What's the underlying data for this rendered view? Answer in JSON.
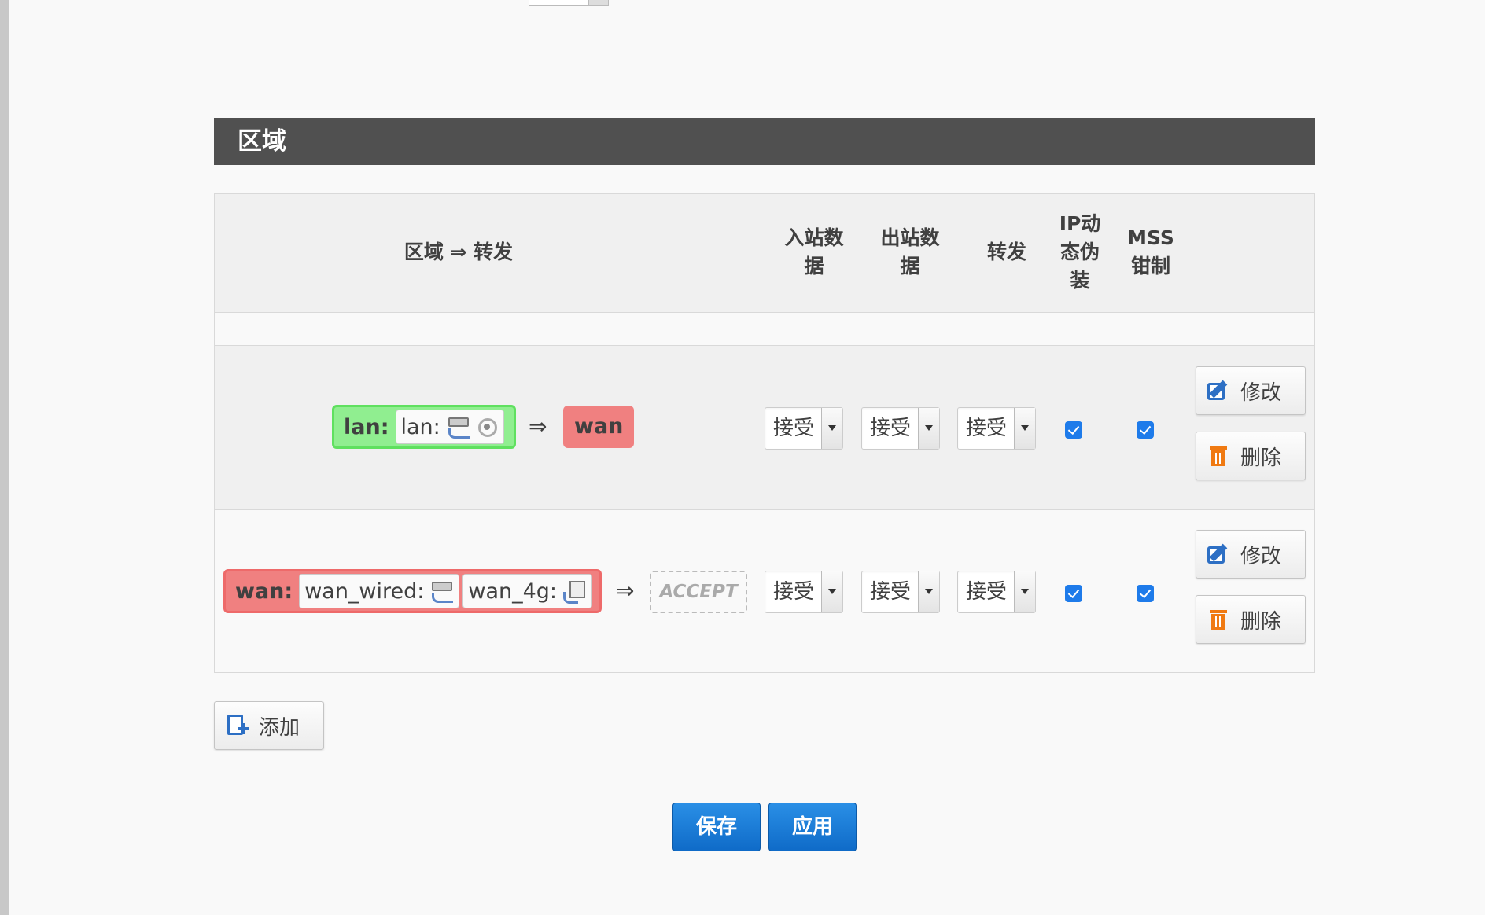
{
  "section": {
    "title": "区域"
  },
  "table": {
    "headers": {
      "zone_forward": "区域 ⇒ 转发",
      "input": [
        "入站数",
        "据"
      ],
      "output": [
        "出站数",
        "据"
      ],
      "forward": "转发",
      "masq": [
        "IP动",
        "态伪",
        "装"
      ],
      "mss": [
        "MSS",
        "钳制"
      ]
    },
    "rows": [
      {
        "zone": "lan:",
        "interfaces": [
          "lan:"
        ],
        "arrow": "⇒",
        "dest": "wan",
        "input": "接受",
        "output": "接受",
        "forward": "接受",
        "masq": true,
        "mss": true,
        "edit_label": "修改",
        "delete_label": "删除"
      },
      {
        "zone": "wan:",
        "interfaces": [
          "wan_wired:",
          "wan_4g:"
        ],
        "arrow": "⇒",
        "dest": "ACCEPT",
        "input": "接受",
        "output": "接受",
        "forward": "接受",
        "masq": true,
        "mss": true,
        "edit_label": "修改",
        "delete_label": "删除"
      }
    ]
  },
  "add_label": "添加",
  "save_label": "保存",
  "apply_label": "应用",
  "colors": {
    "lan_zone": "#90ee90",
    "wan_zone": "#f08080",
    "header_bg": "#505050",
    "primary": "#1a7cd8"
  }
}
